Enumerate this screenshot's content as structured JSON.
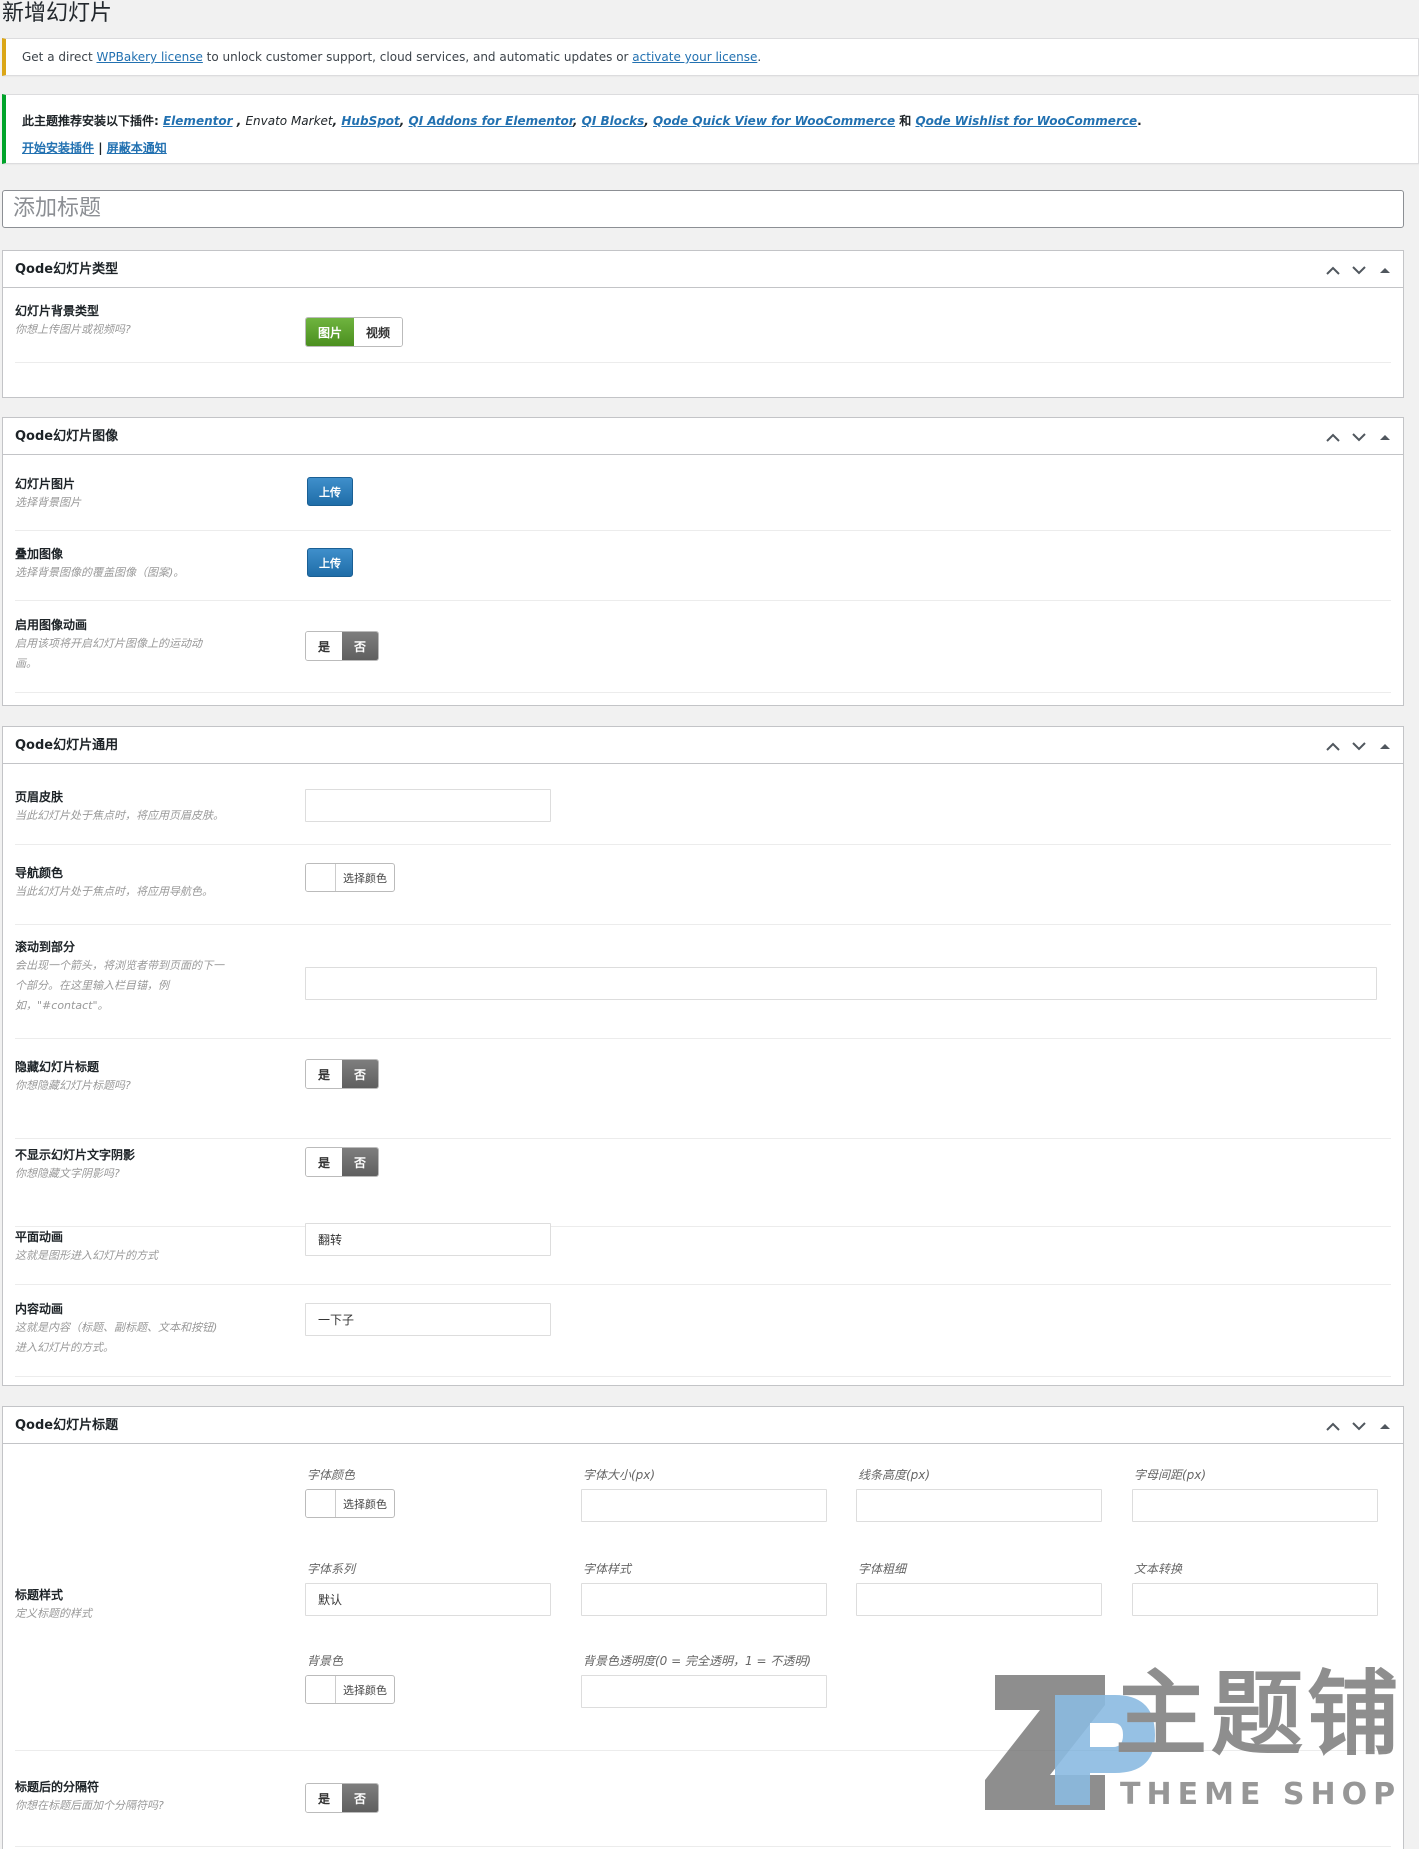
{
  "page": {
    "title": "新增幻灯片"
  },
  "notices": {
    "license": {
      "prefix": "Get a direct ",
      "link1": "WPBakery license",
      "middle": " to unlock customer support, cloud services, and automatic updates or ",
      "link2": "activate your license",
      "suffix": "."
    },
    "plugins": {
      "prefix": "此主题推荐安装以下插件: ",
      "p1": "Elementor",
      "sep1": " , ",
      "p2": "Envato Market",
      "sep2": ", ",
      "p3": "HubSpot",
      "sep3": ", ",
      "p4": "QI Addons for Elementor",
      "sep4": ", ",
      "p5": "QI Blocks",
      "sep5": ", ",
      "p6": "Qode Quick View for WooCommerce",
      "and": " 和 ",
      "p7": "Qode Wishlist for WooCommerce",
      "end": ".",
      "install_link": "开始安装插件",
      "divider": " | ",
      "dismiss_link": "屏蔽本通知"
    }
  },
  "title_input": {
    "placeholder": "添加标题"
  },
  "boxes": {
    "type": {
      "title": "Qode幻灯片类型",
      "bg_type": {
        "label": "幻灯片背景类型",
        "desc": "你想上传图片或视频吗?",
        "opt_image": "图片",
        "opt_video": "视频"
      }
    },
    "image": {
      "title": "Qode幻灯片图像",
      "slide_image": {
        "label": "幻灯片图片",
        "desc": "选择背景图片",
        "button": "上传"
      },
      "overlay_image": {
        "label": "叠加图像",
        "desc": "选择背景图像的覆盖图像（图案)。",
        "button": "上传"
      },
      "image_animation": {
        "label": "启用图像动画",
        "desc1": "启用该项将开启幻灯片图像上的运动动",
        "desc2": "画。",
        "yes": "是",
        "no": "否"
      }
    },
    "general": {
      "title": "Qode幻灯片通用",
      "header_skin": {
        "label": "页眉皮肤",
        "desc": "当此幻灯片处于焦点时，将应用页眉皮肤。",
        "value": ""
      },
      "nav_color": {
        "label": "导航颜色",
        "desc": "当此幻灯片处于焦点时，将应用导航色。",
        "button": "选择颜色"
      },
      "scroll_to": {
        "label": "滚动到部分",
        "desc1": "会出现一个箭头，将浏览者带到页面的下一",
        "desc2": "个部分。在这里输入栏目锚，例",
        "desc3": "如，\"#contact\"。",
        "value": ""
      },
      "hide_title": {
        "label": "隐藏幻灯片标题",
        "desc": "你想隐藏幻灯片标题吗?",
        "yes": "是",
        "no": "否"
      },
      "no_shadow": {
        "label": "不显示幻灯片文字阴影",
        "desc": "你想隐藏文字阴影吗?",
        "yes": "是",
        "no": "否"
      },
      "graphic_anim": {
        "label": "平面动画",
        "desc": "这就是图形进入幻灯片的方式",
        "value": "翻转"
      },
      "content_anim": {
        "label": "内容动画",
        "desc1": "这就是内容（标题、副标题、文本和按钮)",
        "desc2": "进入幻灯片的方式。",
        "value": "一下子"
      }
    },
    "title_box": {
      "title": "Qode幻灯片标题",
      "title_style": {
        "label": "标题样式",
        "desc": "定义标题的样式",
        "font_color": "字体颜色",
        "font_size": "字体大小(px)",
        "line_height": "线条高度(px)",
        "letter_spacing": "字母间距(px)",
        "font_family": "字体系列",
        "font_family_value": "默认",
        "font_style": "字体样式",
        "font_weight": "字体粗细",
        "text_transform": "文本转换",
        "bg_color": "背景色",
        "bg_opacity": "背景色透明度(0 = 完全透明，1 = 不透明)",
        "choose_color": "选择颜色"
      },
      "separator": {
        "label": "标题后的分隔符",
        "desc": "你想在标题后面加个分隔符吗?",
        "yes": "是",
        "no": "否"
      }
    }
  },
  "watermark": {
    "brand": "主题铺",
    "sub": "THEME SHOP"
  },
  "colors": {
    "accent": "#2271b1",
    "green": "#5ca22c",
    "upload_blue": "#2a7bb8",
    "warning": "#dba617",
    "success": "#00a32a"
  }
}
